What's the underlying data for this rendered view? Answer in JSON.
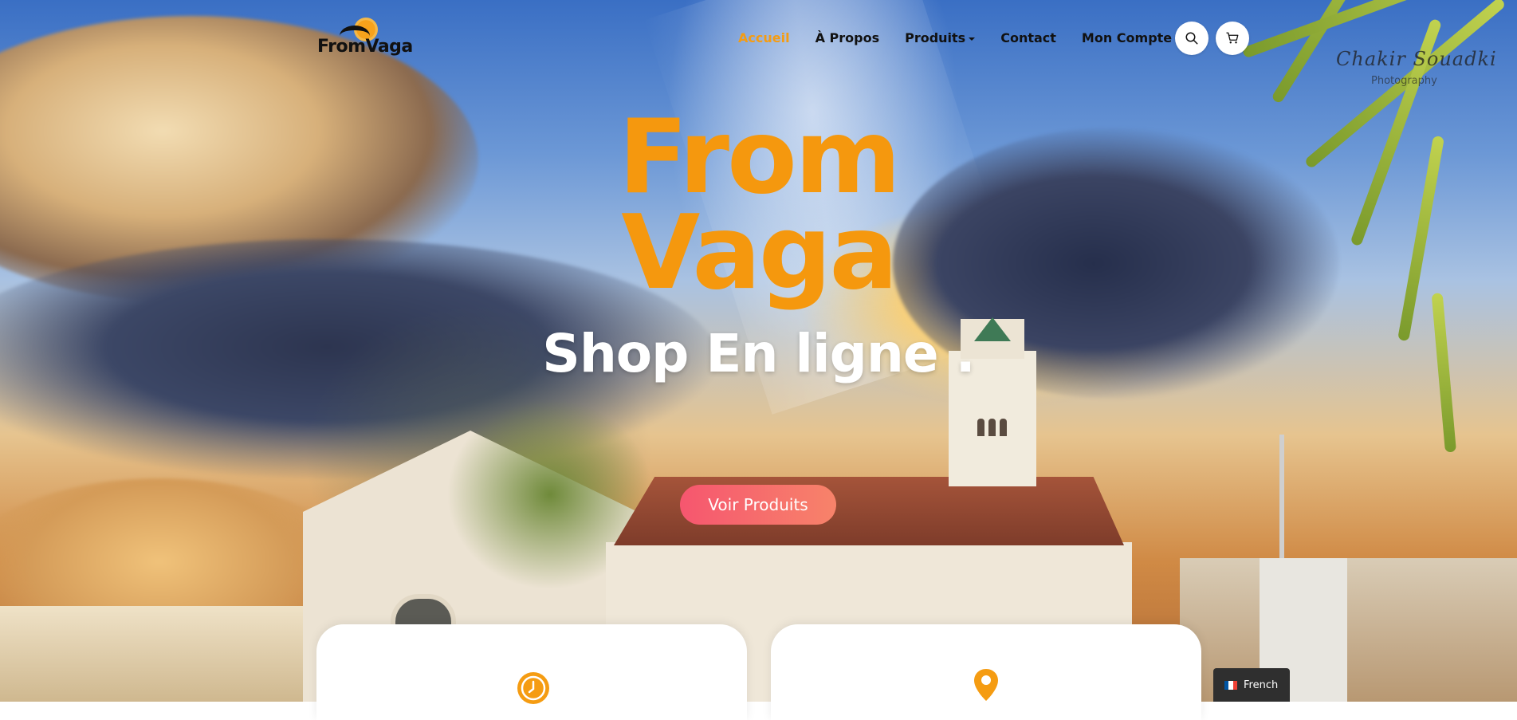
{
  "header": {
    "logo_text": "FromVaga",
    "nav": [
      {
        "label": "Accueil",
        "active": true
      },
      {
        "label": "À Propos"
      },
      {
        "label": "Produits",
        "has_dropdown": true
      },
      {
        "label": "Contact"
      },
      {
        "label": "Mon Compte"
      }
    ],
    "search_icon": "search-icon",
    "cart_icon": "cart-icon"
  },
  "watermark": {
    "signature": "Chakir Souadki",
    "subtitle": "Photography"
  },
  "hero": {
    "title_line1": "From",
    "title_line2": "Vaga",
    "subtitle": "Shop En ligne .",
    "cta_label": "Voir Produits"
  },
  "cards": [
    {
      "icon": "clock-icon"
    },
    {
      "icon": "location-pin-icon"
    }
  ],
  "language": {
    "label": "French",
    "flag": "flag-fr-icon"
  },
  "colors": {
    "accent": "#f5980e",
    "cta_start": "#f6566f",
    "cta_end": "#f7836a",
    "nav_text": "#111111"
  }
}
